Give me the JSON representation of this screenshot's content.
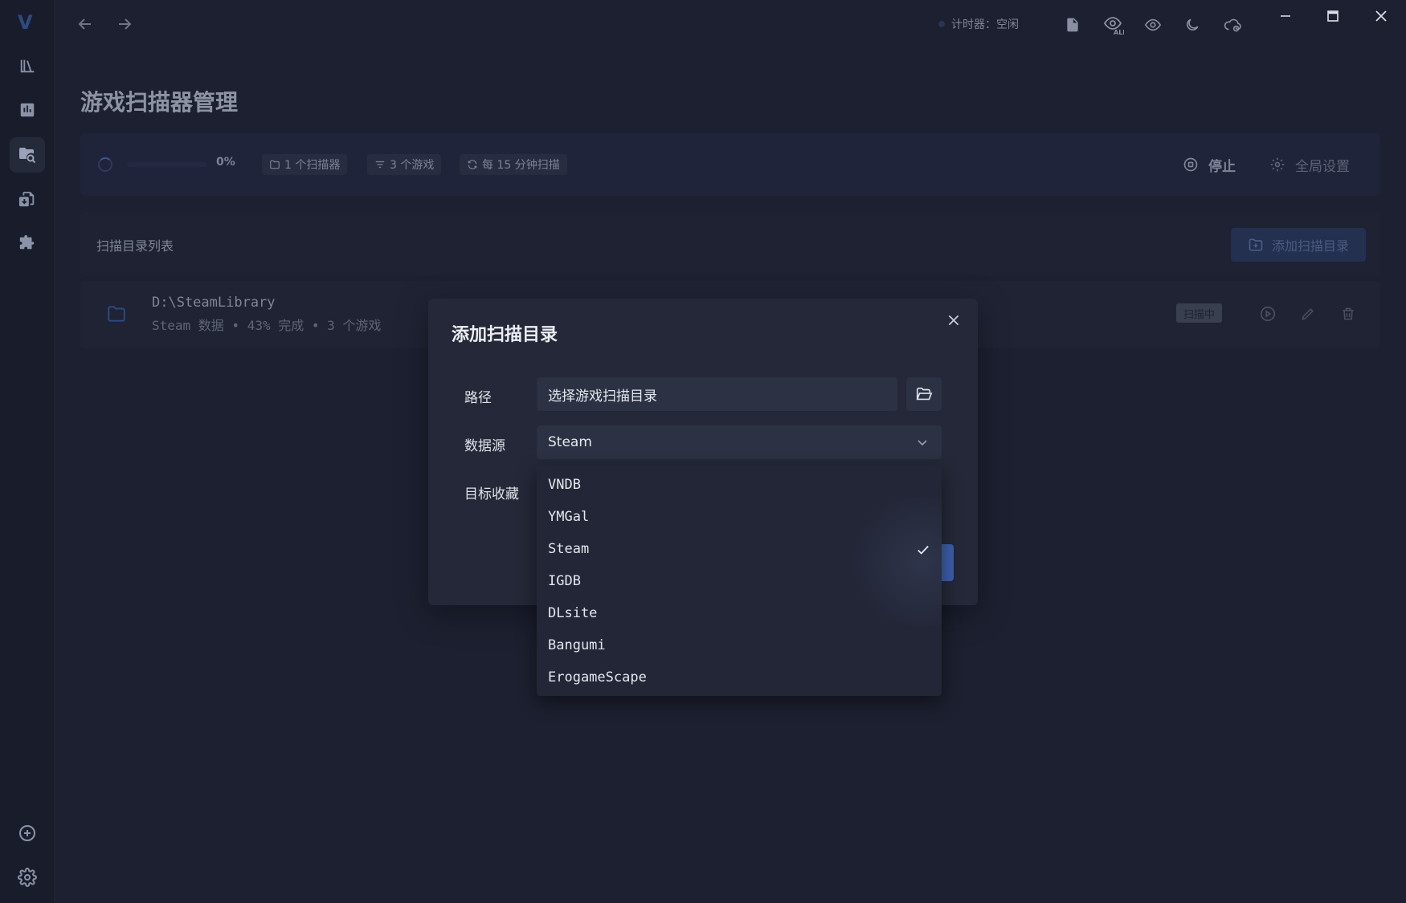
{
  "app": {
    "logo_letter": "V"
  },
  "topbar": {
    "timer_text": "计时器：空闲"
  },
  "page": {
    "title": "游戏扫描器管理"
  },
  "status": {
    "progress": 0,
    "progress_text": "0%",
    "chip_scanners": "1 个扫描器",
    "chip_games": "3 个游戏",
    "chip_interval": "每 15 分钟扫描",
    "stop_label": "停止",
    "global_settings_label": "全局设置"
  },
  "list": {
    "title": "扫描目录列表",
    "add_button_label": "添加扫描目录",
    "rows": [
      {
        "path": "D:\\SteamLibrary",
        "meta": "Steam 数据 • 43% 完成 • 3 个游戏",
        "badge": "扫描中"
      }
    ]
  },
  "modal": {
    "title": "添加扫描目录",
    "path_label": "路径",
    "path_placeholder": "选择游戏扫描目录",
    "source_label": "数据源",
    "source_value": "Steam",
    "target_label": "目标收藏",
    "source_options": [
      "VNDB",
      "YMGal",
      "Steam",
      "IGDB",
      "DLsite",
      "Bangumi",
      "ErogameScape"
    ],
    "selected_option": "Steam"
  }
}
